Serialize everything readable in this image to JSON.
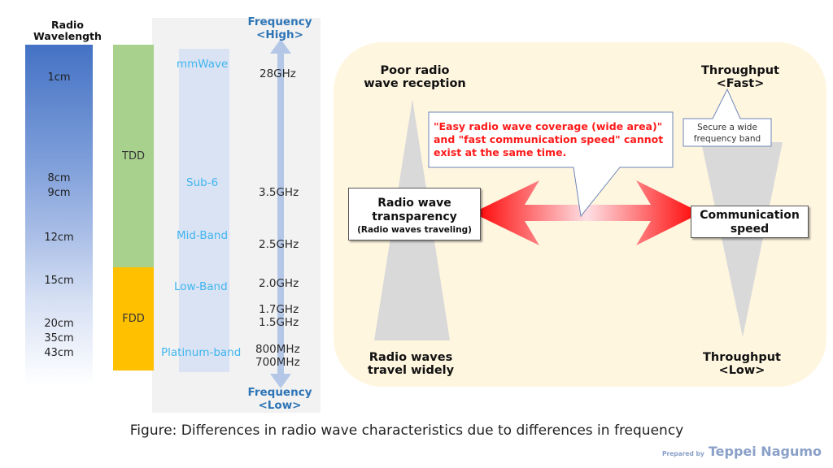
{
  "wavelength": {
    "title_line1": "Radio",
    "title_line2": "Wavelength",
    "labels": [
      "1cm",
      "8cm",
      "9cm",
      "12cm",
      "15cm",
      "20cm",
      "35cm",
      "43cm"
    ],
    "color_top": "#4472c4"
  },
  "duplex": {
    "tdd": {
      "label": "TDD",
      "color": "#a9d18e"
    },
    "fdd": {
      "label": "FDD",
      "color": "#ffc000"
    }
  },
  "bands": [
    "mmWave",
    "Sub-6",
    "Mid-Band",
    "Low-Band",
    "Platinum-band"
  ],
  "frequencies": [
    "28GHz",
    "3.5GHz",
    "2.5GHz",
    "2.0GHz",
    "1.7GHz",
    "1.5GHz",
    "800MHz",
    "700MHz"
  ],
  "frequency_axis": {
    "top_line1": "Frequency",
    "top_line2": "<High>",
    "bottom_line1": "Frequency",
    "bottom_line2": "<Low>"
  },
  "tradeoff": {
    "poor_reception_line1": "Poor radio",
    "poor_reception_line2": "wave reception",
    "travel_widely_line1": "Radio waves",
    "travel_widely_line2": "travel widely",
    "throughput_fast_line1": "Throughput",
    "throughput_fast_line2": "<Fast>",
    "throughput_low_line1": "Throughput",
    "throughput_low_line2": "<Low>",
    "transparency_line1": "Radio wave",
    "transparency_line2": "transparency",
    "transparency_sub": "(Radio waves traveling)",
    "speed_line1": "Communication",
    "speed_line2": "speed",
    "callout_line1": "\"Easy radio wave coverage (wide area)\"",
    "callout_line2": "and \"fast communication speed\" cannot",
    "callout_line3": "exist at the same time.",
    "small_callout_line1": "Secure a wide",
    "small_callout_line2": "frequency band",
    "arrow_color": "#ff0000"
  },
  "caption": "Figure: Differences in radio wave characteristics due to differences in frequency",
  "credit": {
    "prefix": "Prepared by",
    "name": "Teppei Nagumo"
  }
}
